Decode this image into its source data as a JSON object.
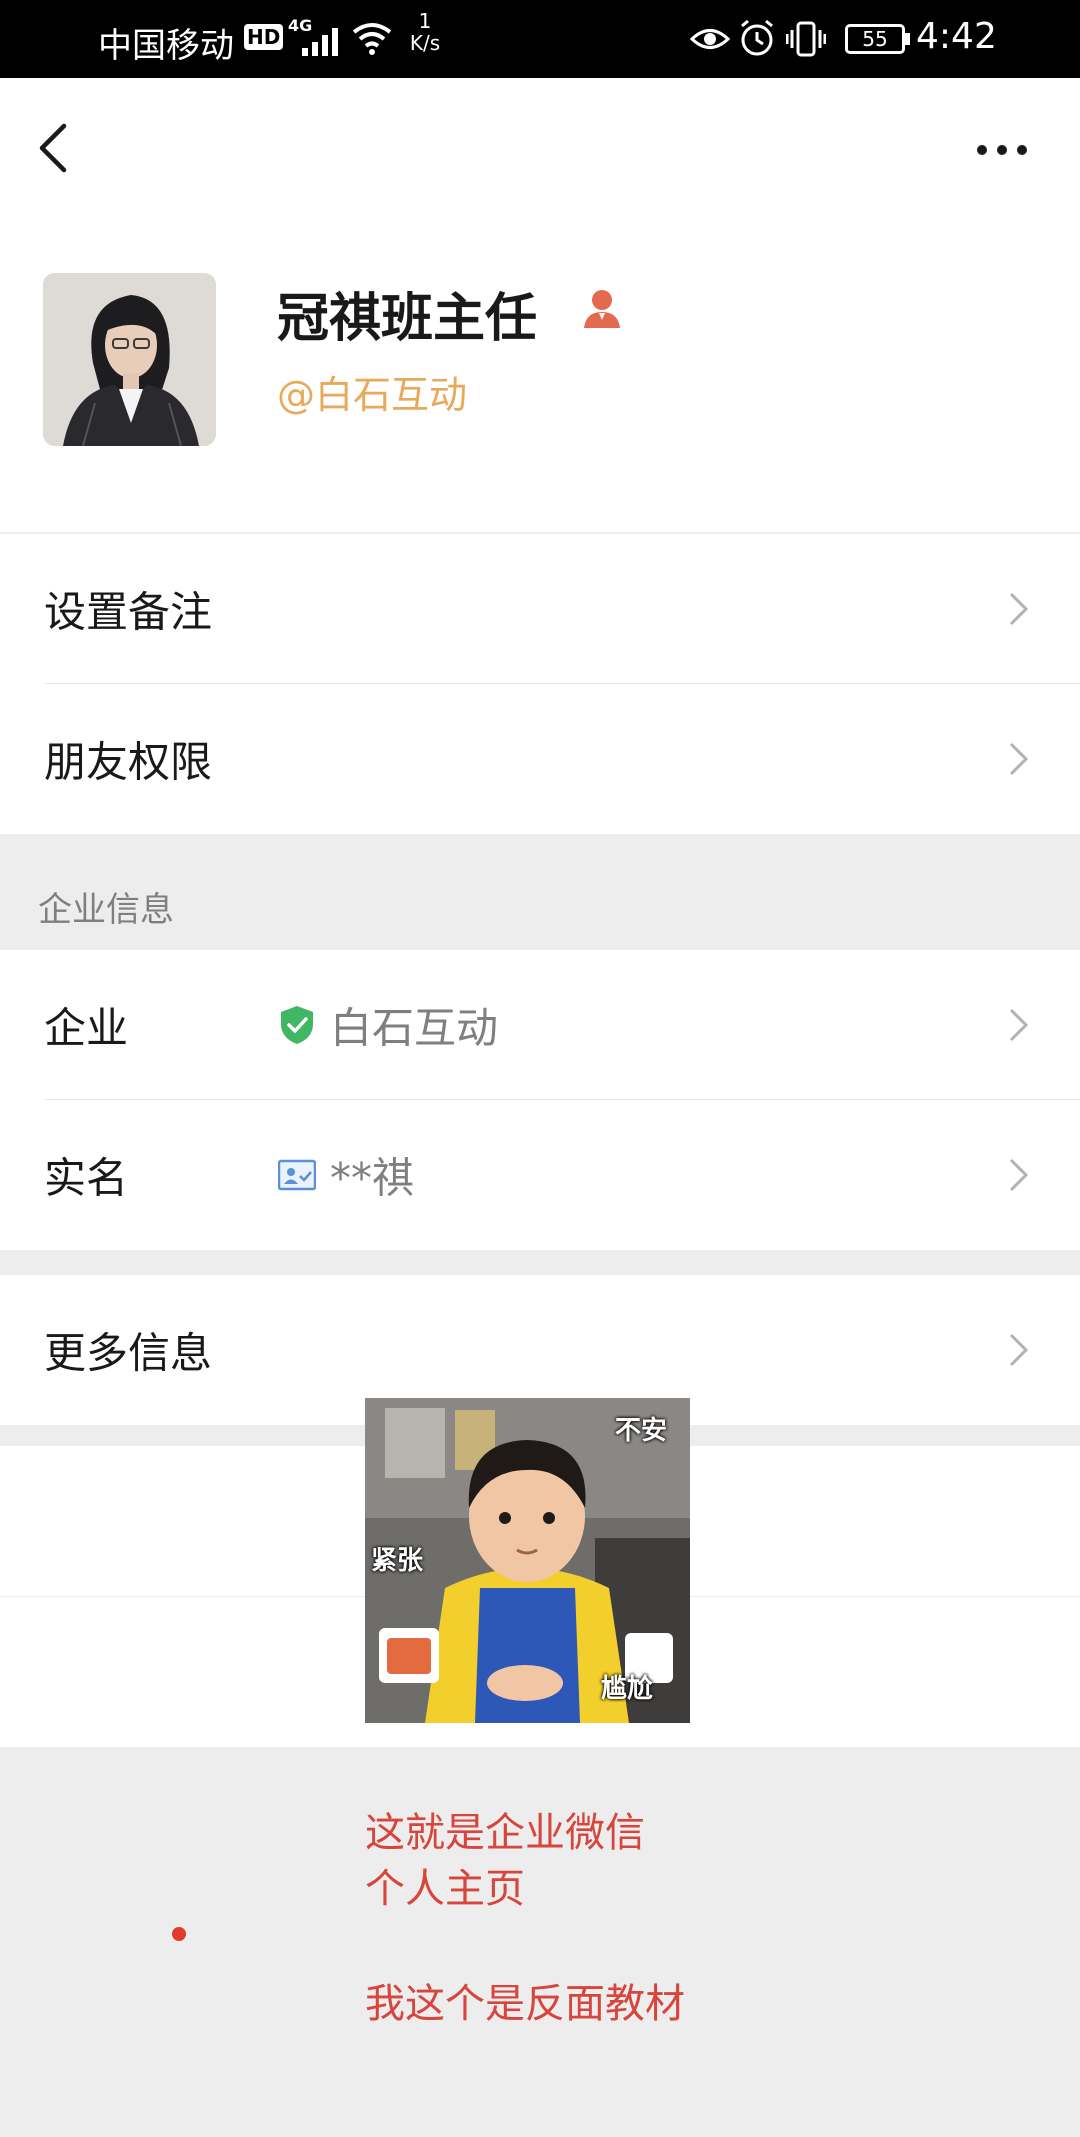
{
  "status_bar": {
    "carrier": "中国移动",
    "hd_badge": "HD",
    "network": "4G",
    "speed_value": "1",
    "speed_unit": "K/s",
    "battery": "55",
    "time": "4:42"
  },
  "profile": {
    "name": "冠祺班主任",
    "company_tag": "@白石互动"
  },
  "menu": {
    "remark_label": "设置备注",
    "permission_label": "朋友权限",
    "section_title": "企业信息",
    "company_label": "企业",
    "company_value": "白石互动",
    "realname_label": "实名",
    "realname_value": "**祺",
    "more_label": "更多信息"
  },
  "meme": {
    "word_1": "不安",
    "word_2": "紧张",
    "word_3": "尴尬"
  },
  "annotation": {
    "line_1": "这就是企业微信",
    "line_2": "个人主页",
    "line_3": "我这个是反面教材"
  },
  "colors": {
    "brand_orange": "#e9a95a",
    "verified_green": "#3fb765",
    "annotation_red": "#d7453c"
  }
}
